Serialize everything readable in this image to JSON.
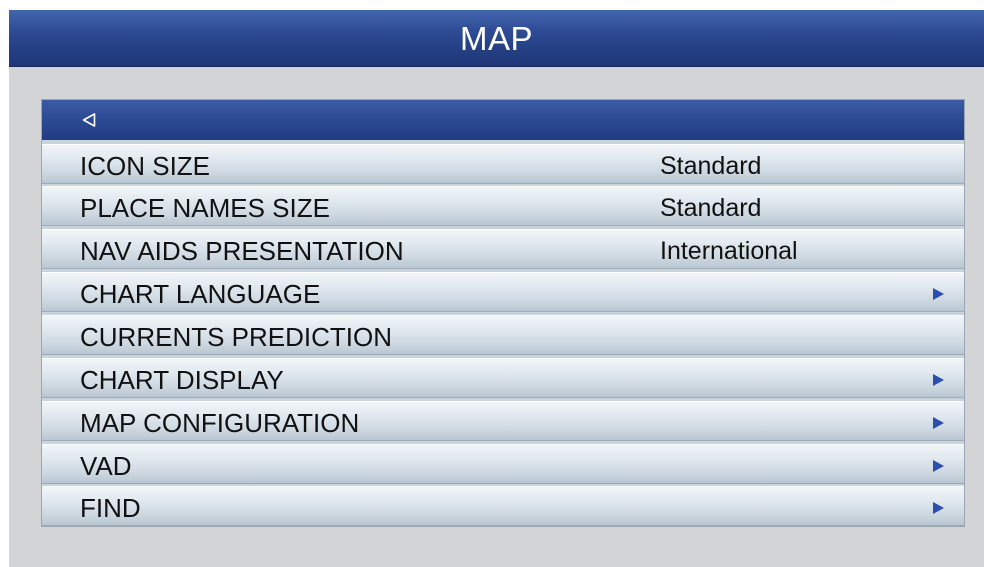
{
  "header": {
    "title": "MAP"
  },
  "back": {
    "icon": "back-triangle-icon"
  },
  "menu": {
    "items": [
      {
        "label": "ICON SIZE",
        "value": "Standard",
        "submenu": false
      },
      {
        "label": "PLACE NAMES SIZE",
        "value": "Standard",
        "submenu": false
      },
      {
        "label": "NAV AIDS PRESENTATION",
        "value": "International",
        "submenu": false
      },
      {
        "label": "CHART LANGUAGE",
        "value": "",
        "submenu": true
      },
      {
        "label": "CURRENTS PREDICTION",
        "value": "",
        "submenu": false
      },
      {
        "label": "CHART DISPLAY",
        "value": "",
        "submenu": true
      },
      {
        "label": "MAP CONFIGURATION",
        "value": "",
        "submenu": true
      },
      {
        "label": "VAD",
        "value": "",
        "submenu": true
      },
      {
        "label": "FIND",
        "value": "",
        "submenu": true
      }
    ]
  },
  "colors": {
    "title_bar": "#2f4d96",
    "selected_row": "#2c4a93",
    "row_background": "#dfe7ee",
    "arrow": "#2b4fae",
    "text": "#111111"
  }
}
